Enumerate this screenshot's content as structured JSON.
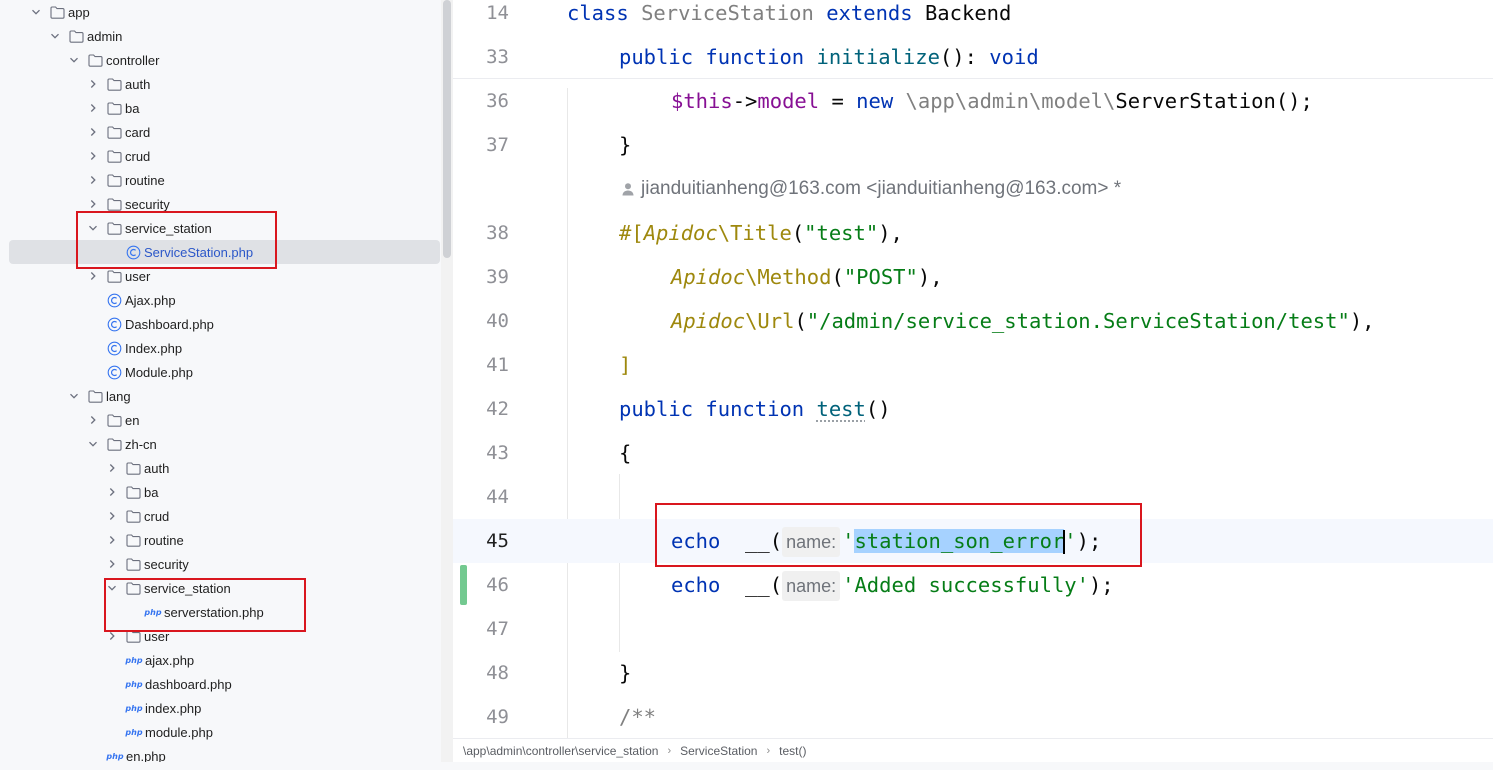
{
  "tree": {
    "items": [
      {
        "label": "app",
        "type": "folder",
        "expanded": true
      },
      {
        "label": "admin",
        "type": "folder",
        "expanded": true
      },
      {
        "label": "controller",
        "type": "folder",
        "expanded": true
      },
      {
        "label": "auth",
        "type": "folder",
        "expanded": false
      },
      {
        "label": "ba",
        "type": "folder",
        "expanded": false
      },
      {
        "label": "card",
        "type": "folder",
        "expanded": false
      },
      {
        "label": "crud",
        "type": "folder",
        "expanded": false
      },
      {
        "label": "routine",
        "type": "folder",
        "expanded": false
      },
      {
        "label": "security",
        "type": "folder",
        "expanded": false
      },
      {
        "label": "service_station",
        "type": "folder",
        "expanded": true
      },
      {
        "label": "ServiceStation.php",
        "type": "class",
        "selected": true
      },
      {
        "label": "user",
        "type": "folder",
        "expanded": false
      },
      {
        "label": "Ajax.php",
        "type": "class"
      },
      {
        "label": "Dashboard.php",
        "type": "class"
      },
      {
        "label": "Index.php",
        "type": "class"
      },
      {
        "label": "Module.php",
        "type": "class"
      },
      {
        "label": "lang",
        "type": "folder",
        "expanded": true
      },
      {
        "label": "en",
        "type": "folder",
        "expanded": false
      },
      {
        "label": "zh-cn",
        "type": "folder",
        "expanded": true
      },
      {
        "label": "auth",
        "type": "folder",
        "expanded": false
      },
      {
        "label": "ba",
        "type": "folder",
        "expanded": false
      },
      {
        "label": "crud",
        "type": "folder",
        "expanded": false
      },
      {
        "label": "routine",
        "type": "folder",
        "expanded": false
      },
      {
        "label": "security",
        "type": "folder",
        "expanded": false
      },
      {
        "label": "service_station",
        "type": "folder",
        "expanded": true
      },
      {
        "label": "serverstation.php",
        "type": "php"
      },
      {
        "label": "user",
        "type": "folder",
        "expanded": false
      },
      {
        "label": "ajax.php",
        "type": "php"
      },
      {
        "label": "dashboard.php",
        "type": "php"
      },
      {
        "label": "index.php",
        "type": "php"
      },
      {
        "label": "module.php",
        "type": "php"
      },
      {
        "label": "en.php",
        "type": "php"
      }
    ],
    "php_badge": "php"
  },
  "editor": {
    "line_numbers": [
      "14",
      "33",
      "36",
      "37",
      "38",
      "39",
      "40",
      "41",
      "42",
      "43",
      "44",
      "45",
      "46",
      "47",
      "48",
      "49"
    ],
    "l14": {
      "kw1": "class",
      "name": "ServiceStation",
      "kw2": "extends",
      "base": "Backend"
    },
    "l33": {
      "kw1": "public",
      "kw2": "function",
      "fn": "initialize",
      "mid": "(): ",
      "kw3": "void"
    },
    "l36": {
      "var": "$this",
      "arrow": "->",
      "prop": "model",
      "eq": " = ",
      "kw": "new",
      "ns": " \\app\\admin\\model\\",
      "cls": "ServerStation",
      "end": "();"
    },
    "l37": {
      "text": "}"
    },
    "author": {
      "text": "jianduitianheng@163.com <jianduitianheng@163.com> *"
    },
    "l38": {
      "hash": "#[",
      "ns": "Apidoc",
      "sep": "\\",
      "cls": "Title",
      "open": "(",
      "str": "\"test\"",
      "close": "),"
    },
    "l39": {
      "ns": "Apidoc",
      "sep": "\\",
      "cls": "Method",
      "open": "(",
      "str": "\"POST\"",
      "close": "),"
    },
    "l40": {
      "ns": "Apidoc",
      "sep": "\\",
      "cls": "Url",
      "open": "(",
      "str": "\"/admin/service_station.ServiceStation/test\"",
      "close": "),"
    },
    "l41": {
      "text": "]"
    },
    "l42": {
      "kw1": "public",
      "kw2": "function",
      "fn": "test",
      "end": "()"
    },
    "l43": {
      "text": "{"
    },
    "l45": {
      "kw": "echo",
      "call": "  __(",
      "hint": "name:",
      "q1": "'",
      "sel": "station_son_error",
      "q2": "'",
      "end": ");"
    },
    "l46": {
      "kw": "echo",
      "call": "  __(",
      "hint": "name:",
      "str": "'Added successfully'",
      "end": ");"
    },
    "l48": {
      "text": "}"
    },
    "l49": {
      "text": "/**"
    }
  },
  "breadcrumb": {
    "items": [
      "\\app\\admin\\controller\\service_station",
      "ServiceStation",
      "test()"
    ],
    "separator": "›"
  },
  "colors": {
    "keyword": "#0033b3",
    "function": "#00627a",
    "string": "#067d17",
    "attribute": "#9e880d",
    "highlight_box": "#d9161e",
    "selection": "#a6d2ff",
    "change_marker": "#73c990"
  }
}
